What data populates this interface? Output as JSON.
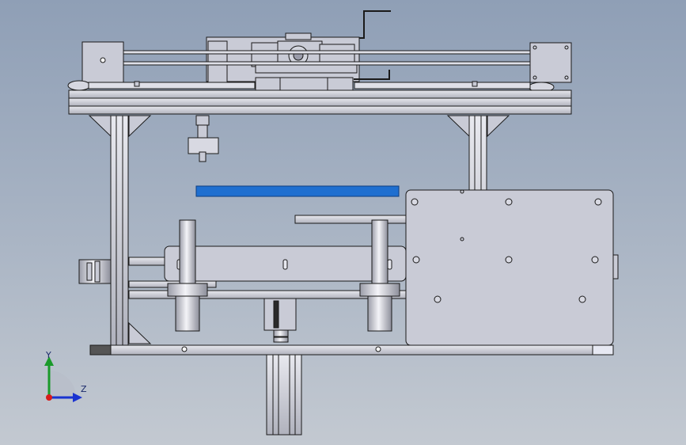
{
  "viewport": {
    "background_top": "#8f9fb6",
    "background_bottom": "#c3c9d1"
  },
  "model": {
    "highlight_color": "#1f6fd0",
    "part_fill": "#c9cbd6",
    "edge_color": "#1a1a1a"
  },
  "triad": {
    "y_label": "Y",
    "z_label": "Z",
    "x_axis_color": "#d81b1b",
    "y_axis_color": "#1a9a2a",
    "z_axis_color": "#1a33d0"
  }
}
